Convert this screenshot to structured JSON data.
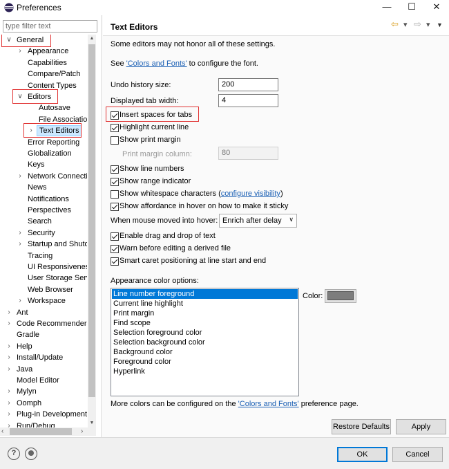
{
  "window": {
    "title": "Preferences",
    "minimize": "—",
    "maximize": "☐",
    "close": "✕"
  },
  "filter": {
    "placeholder": "type filter text"
  },
  "tree": [
    {
      "label": "General",
      "indent": 0,
      "arrow": "∨",
      "boxed": true
    },
    {
      "label": "Appearance",
      "indent": 1,
      "arrow": "›"
    },
    {
      "label": "Capabilities",
      "indent": 1,
      "arrow": ""
    },
    {
      "label": "Compare/Patch",
      "indent": 1,
      "arrow": ""
    },
    {
      "label": "Content Types",
      "indent": 1,
      "arrow": ""
    },
    {
      "label": "Editors",
      "indent": 1,
      "arrow": "∨",
      "boxed": true
    },
    {
      "label": "Autosave",
      "indent": 2,
      "arrow": ""
    },
    {
      "label": "File Associations",
      "indent": 2,
      "arrow": ""
    },
    {
      "label": "Text Editors",
      "indent": 2,
      "arrow": "›",
      "boxed": true,
      "selected": true
    },
    {
      "label": "Error Reporting",
      "indent": 1,
      "arrow": ""
    },
    {
      "label": "Globalization",
      "indent": 1,
      "arrow": ""
    },
    {
      "label": "Keys",
      "indent": 1,
      "arrow": ""
    },
    {
      "label": "Network Connections",
      "indent": 1,
      "arrow": "›"
    },
    {
      "label": "News",
      "indent": 1,
      "arrow": ""
    },
    {
      "label": "Notifications",
      "indent": 1,
      "arrow": ""
    },
    {
      "label": "Perspectives",
      "indent": 1,
      "arrow": ""
    },
    {
      "label": "Search",
      "indent": 1,
      "arrow": ""
    },
    {
      "label": "Security",
      "indent": 1,
      "arrow": "›"
    },
    {
      "label": "Startup and Shutdown",
      "indent": 1,
      "arrow": "›"
    },
    {
      "label": "Tracing",
      "indent": 1,
      "arrow": ""
    },
    {
      "label": "UI Responsiveness",
      "indent": 1,
      "arrow": ""
    },
    {
      "label": "User Storage Service",
      "indent": 1,
      "arrow": ""
    },
    {
      "label": "Web Browser",
      "indent": 1,
      "arrow": ""
    },
    {
      "label": "Workspace",
      "indent": 1,
      "arrow": "›"
    },
    {
      "label": "Ant",
      "indent": 0,
      "arrow": "›"
    },
    {
      "label": "Code Recommenders",
      "indent": 0,
      "arrow": "›"
    },
    {
      "label": "Gradle",
      "indent": 0,
      "arrow": ""
    },
    {
      "label": "Help",
      "indent": 0,
      "arrow": "›"
    },
    {
      "label": "Install/Update",
      "indent": 0,
      "arrow": "›"
    },
    {
      "label": "Java",
      "indent": 0,
      "arrow": "›"
    },
    {
      "label": "Model Editor",
      "indent": 0,
      "arrow": ""
    },
    {
      "label": "Mylyn",
      "indent": 0,
      "arrow": "›"
    },
    {
      "label": "Oomph",
      "indent": 0,
      "arrow": "›"
    },
    {
      "label": "Plug-in Development",
      "indent": 0,
      "arrow": "›"
    },
    {
      "label": "Run/Debug",
      "indent": 0,
      "arrow": "›"
    }
  ],
  "page": {
    "title": "Text Editors",
    "note": "Some editors may not honor all of these settings.",
    "see_prefix": "See ",
    "see_link": "'Colors and Fonts'",
    "see_suffix": " to configure the font.",
    "undo_label": "Undo history size:",
    "undo_value": "200",
    "tab_label": "Displayed tab width:",
    "tab_value": "4",
    "checkboxes": [
      {
        "label": "Insert spaces for tabs",
        "checked": true
      },
      {
        "label": "Highlight current line",
        "checked": true
      },
      {
        "label": "Show print margin",
        "checked": false
      }
    ],
    "print_margin_label": "Print margin column:",
    "print_margin_value": "80",
    "checkboxes2": [
      {
        "label": "Show line numbers",
        "checked": true
      },
      {
        "label": "Show range indicator",
        "checked": true
      },
      {
        "label": "Show whitespace characters (",
        "checked": false
      },
      {
        "label": "Show affordance in hover on how to make it sticky",
        "checked": true
      }
    ],
    "whitespace_link": "configure visibility",
    "whitespace_close": ")",
    "hover_label": "When mouse moved into hover:",
    "hover_value": "Enrich after delay",
    "checkboxes3": [
      {
        "label": "Enable drag and drop of text",
        "checked": true
      },
      {
        "label": "Warn before editing a derived file",
        "checked": true
      },
      {
        "label": "Smart caret positioning at line start and end",
        "checked": true
      }
    ],
    "appearance_label": "Appearance color options:",
    "color_options": [
      "Line number foreground",
      "Current line highlight",
      "Print margin",
      "Find scope",
      "Selection foreground color",
      "Selection background color",
      "Background color",
      "Foreground color",
      "Hyperlink"
    ],
    "color_label": "Color:",
    "swatch_color": "#7d7d7d",
    "more_prefix": "More colors can be configured on the ",
    "more_link": "'Colors and Fonts'",
    "more_suffix": " preference page.",
    "restore_label": "Restore Defaults",
    "apply_label": "Apply"
  },
  "footer": {
    "help_icon": "?",
    "ok_label": "OK",
    "cancel_label": "Cancel"
  },
  "toolbar": {
    "back": "⇦",
    "drop1": "▾",
    "forward": "⇨",
    "drop2": "▾",
    "menu": "▼"
  }
}
